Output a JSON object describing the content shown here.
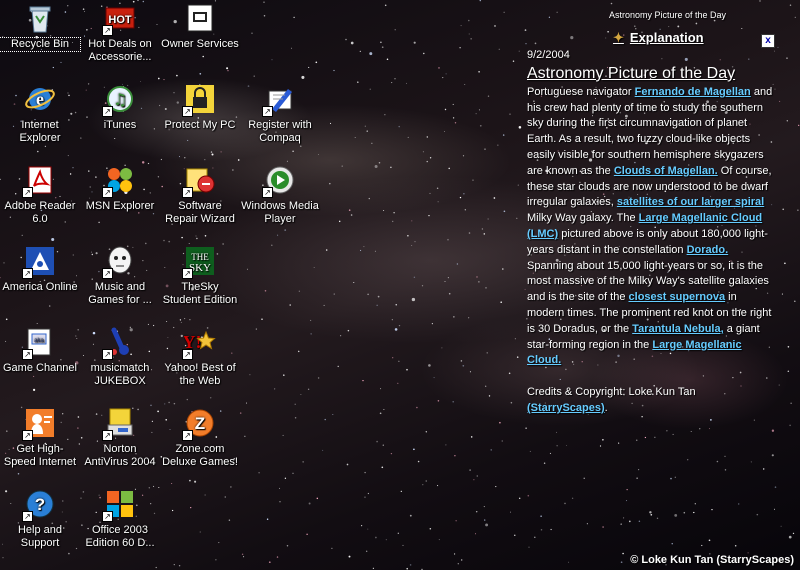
{
  "desktop": {
    "icons": [
      {
        "label": "Recycle Bin",
        "icon": "recycle-bin-icon"
      },
      {
        "label": "Hot Deals on Accessorie...",
        "icon": "hot-deals-icon"
      },
      {
        "label": "Owner Services",
        "icon": "owner-services-icon"
      },
      {
        "label": "Internet Explorer",
        "icon": "internet-explorer-icon"
      },
      {
        "label": "iTunes",
        "icon": "itunes-icon"
      },
      {
        "label": "Protect My PC",
        "icon": "padlock-icon"
      },
      {
        "label": "Register with Compaq",
        "icon": "register-compaq-icon"
      },
      {
        "label": "Adobe Reader 6.0",
        "icon": "adobe-reader-icon"
      },
      {
        "label": "MSN Explorer",
        "icon": "msn-butterfly-icon"
      },
      {
        "label": "Software Repair Wizard",
        "icon": "software-repair-icon"
      },
      {
        "label": "Windows Media Player",
        "icon": "media-player-icon"
      },
      {
        "label": "America Online",
        "icon": "aol-icon"
      },
      {
        "label": "Music and Games for ...",
        "icon": "music-games-icon"
      },
      {
        "label": "TheSky Student Edition",
        "icon": "thesky-icon"
      },
      {
        "label": "Game Channel",
        "icon": "game-channel-icon"
      },
      {
        "label": "musicmatch JUKEBOX",
        "icon": "musicmatch-icon"
      },
      {
        "label": "Yahoo! Best of the Web",
        "icon": "yahoo-icon"
      },
      {
        "label": "Get High-Speed Internet",
        "icon": "high-speed-internet-icon"
      },
      {
        "label": "Norton AntiVirus 2004",
        "icon": "norton-icon"
      },
      {
        "label": "Zone.com Deluxe Games!",
        "icon": "zone-icon"
      },
      {
        "label": "Help and Support",
        "icon": "help-icon"
      },
      {
        "label": "Office 2003 Edition 60 D...",
        "icon": "office-icon"
      }
    ]
  },
  "apod": {
    "brand": "Astronomy Picture of the Day",
    "explanation_link": "Explanation",
    "close": "x",
    "date": "9/2/2004",
    "title": "Astronomy Picture of the Day",
    "body": [
      {
        "t": "Portuguese navigator "
      },
      {
        "l": "Fernando de Magellan"
      },
      {
        "t": " and his crew had plenty of time to study the southern sky during the first circumnavigation of planet Earth. As a result, two fuzzy cloud-like objects easily visible for southern hemisphere skygazers are known as the "
      },
      {
        "l": "Clouds of Magellan."
      },
      {
        "t": " Of course, these star clouds are now understood to be dwarf irregular galaxies, "
      },
      {
        "l": "satellites of our larger spiral"
      },
      {
        "t": " Milky Way galaxy. The "
      },
      {
        "l": "Large Magellanic Cloud (LMC)"
      },
      {
        "t": " pictured above is only about 180,000 light-years distant in the constellation "
      },
      {
        "l": "Dorado."
      },
      {
        "t": " Spanning about 15,000 light-years or so, it is the most massive of the Milky Way's satellite galaxies and is the site of the "
      },
      {
        "l": "closest supernova"
      },
      {
        "t": " in modern times. The prominent red knot on the right is 30 Doradus, or the "
      },
      {
        "l": "Tarantula Nebula,"
      },
      {
        "t": " a giant star-forming region in the "
      },
      {
        "l": "Large Magellanic Cloud."
      }
    ],
    "credits_prefix": "Credits & Copyright: Loke Kun Tan ",
    "credits_link": "(StarryScapes)",
    "credits_suffix": "."
  },
  "footer": {
    "credit": "© Loke Kun Tan  (StarryScapes)"
  }
}
